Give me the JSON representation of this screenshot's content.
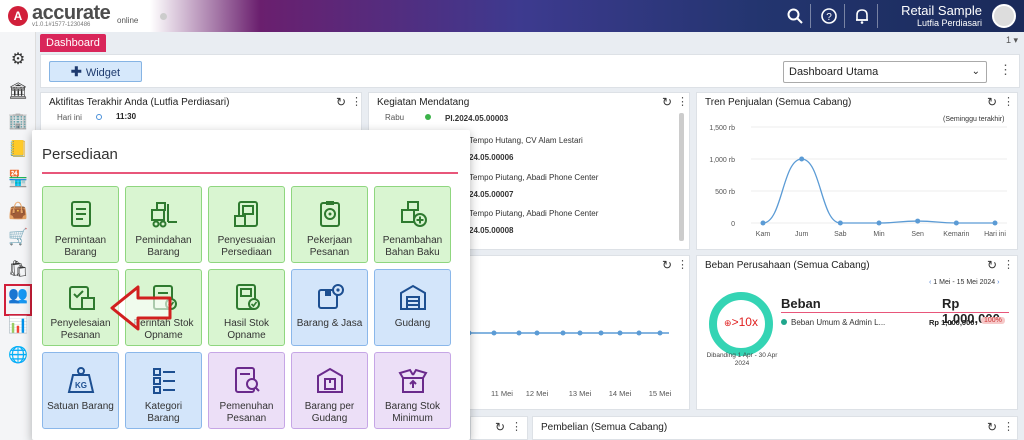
{
  "topbar": {
    "brand": "accurate",
    "brand_suffix": "online",
    "version": "v1.0.1#1577-1230486",
    "user_name": "Retail Sample",
    "user_sub": "Lutfia Perdiasari"
  },
  "tabs": {
    "dashboard": "Dashboard",
    "more": "1 ▾"
  },
  "toolbar": {
    "widget_label": "Widget",
    "dashboard_select": "Dashboard Utama"
  },
  "panels": {
    "aktifitas": {
      "title": "Aktifitas Terakhir Anda (Lutfia Perdiasari)",
      "day": "Hari ini",
      "time": "11:30"
    },
    "kegiatan": {
      "title": "Kegiatan Mendatang",
      "day": "Rabu",
      "rows": [
        {
          "code": "PI.2024.05.00003",
          "desc": "Tempo Hutang, CV Alam Lestari"
        },
        {
          "code": "24.05.00006",
          "desc": "Tempo Piutang, Abadi Phone Center"
        },
        {
          "code": "24.05.00007",
          "desc": "Tempo Piutang, Abadi Phone Center"
        },
        {
          "code": "24.05.00008",
          "desc": ""
        }
      ]
    },
    "tren": {
      "title": "Tren Penjualan (Semua Cabang)",
      "note": "(Seminggu terakhir)"
    },
    "beban": {
      "title": "Beban Perusahaan (Semua Cabang)",
      "range": "1 Mei - 15 Mei 2024",
      "label": "Beban",
      "amount": "Rp 1,000,000",
      "ratio": ">10x",
      "compare": "Dibanding 1 Apr - 30 Apr 2024",
      "item_name": "Beban Umum & Admin L...",
      "item_amount": "Rp 1,000,000",
      "item_pct": "100%"
    },
    "pembelian": {
      "title": "Pembelian (Semua Cabang)"
    },
    "mid_dates": [
      "11 Mei",
      "12 Mei",
      "13 Mei",
      "14 Mei",
      "15 Mei"
    ]
  },
  "chart_data": {
    "type": "line",
    "title": "Tren Penjualan (Semua Cabang)",
    "categories": [
      "Kam",
      "Jum",
      "Sab",
      "Min",
      "Sen",
      "Kemarin",
      "Hari ini"
    ],
    "values": [
      0,
      1000,
      0,
      0,
      30,
      0,
      0
    ],
    "ylim": [
      0,
      1500
    ],
    "yticks": [
      "0",
      "500 rb",
      "1,000 rb",
      "1,500 rb"
    ],
    "color": "#5b9bd5"
  },
  "popup": {
    "title": "Persediaan",
    "tiles": [
      {
        "label": "Permintaan Barang",
        "color": "green",
        "icon": "document-icon"
      },
      {
        "label": "Pemindahan Barang",
        "color": "green",
        "icon": "forklift-icon"
      },
      {
        "label": "Penyesuaian Persediaan",
        "color": "green",
        "icon": "adjust-doc-icon"
      },
      {
        "label": "Pekerjaan Pesanan",
        "color": "green",
        "icon": "gear-clipboard-icon"
      },
      {
        "label": "Penambahan Bahan Baku",
        "color": "green",
        "icon": "add-box-icon"
      },
      {
        "label": "Penyelesaian Pesanan",
        "color": "green",
        "icon": "clipboard-box-icon"
      },
      {
        "label": "Perintah Stok Opname",
        "color": "green",
        "icon": "clipboard-check-icon"
      },
      {
        "label": "Hasil Stok Opname",
        "color": "green",
        "icon": "doc-check-icon"
      },
      {
        "label": "Barang & Jasa",
        "color": "blue",
        "icon": "box-service-icon"
      },
      {
        "label": "Gudang",
        "color": "blue",
        "icon": "warehouse-icon"
      },
      {
        "label": "Satuan Barang",
        "color": "blue",
        "icon": "weight-kg-icon"
      },
      {
        "label": "Kategori Barang",
        "color": "blue",
        "icon": "category-grid-icon"
      },
      {
        "label": "Pemenuhan Pesanan",
        "color": "purple",
        "icon": "doc-search-icon"
      },
      {
        "label": "Barang per Gudang",
        "color": "purple",
        "icon": "warehouse-box-icon"
      },
      {
        "label": "Barang Stok Minimum",
        "color": "purple",
        "icon": "open-box-icon"
      }
    ]
  }
}
